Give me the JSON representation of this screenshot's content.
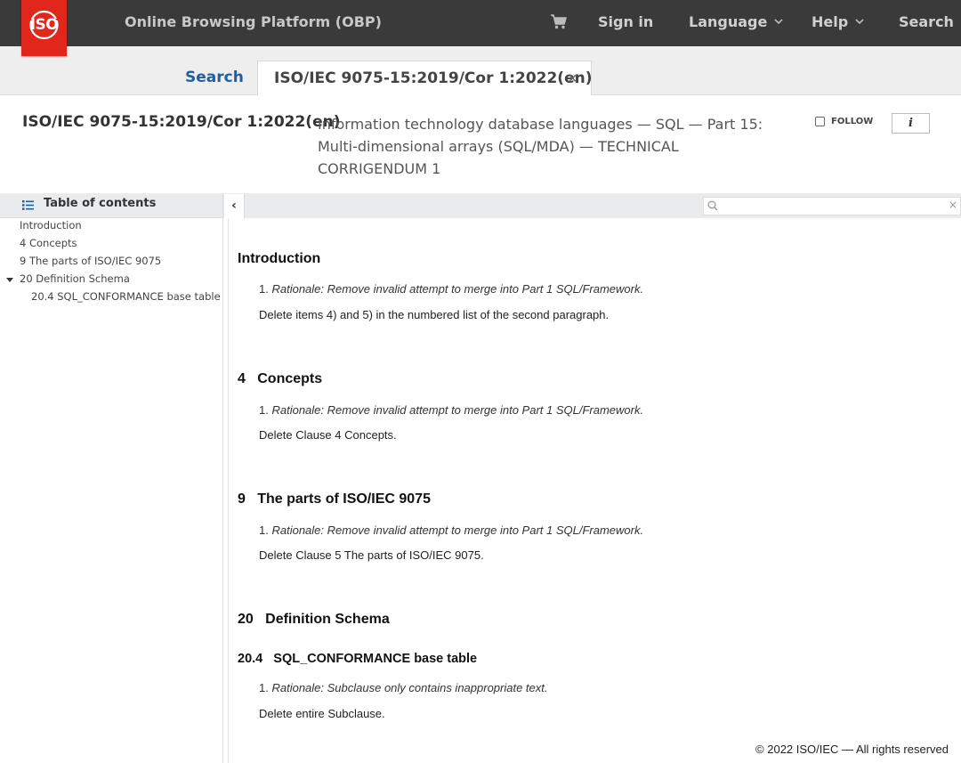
{
  "header": {
    "logo_text": "ISO",
    "app_title": "Online Browsing Platform (OBP)",
    "cart_icon": "cart-icon",
    "nav": {
      "sign_in": "Sign in",
      "language": "Language",
      "help": "Help",
      "search": "Search"
    }
  },
  "tabs": {
    "search_label": "Search",
    "doc_label": "ISO/IEC 9075-15:2019/Cor 1:2022(en)",
    "close_glyph": "×"
  },
  "document": {
    "reference": "ISO/IEC 9075-15:2019/Cor 1:2022(en)",
    "title": "Information technology database languages — SQL — Part 15: Multi-dimensional arrays (SQL/MDA) — TECHNICAL CORRIGENDUM 1",
    "follow_label": "FOLLOW",
    "info_label": "i"
  },
  "toc": {
    "heading": "Table of contents",
    "items": [
      "Introduction",
      "4 Concepts",
      "9 The parts of ISO/IEC 9075",
      "20 Definition Schema",
      "20.4 SQL_CONFORMANCE base table"
    ]
  },
  "toolbar": {
    "collapse_glyph": "‹",
    "search_placeholder": "",
    "clear_glyph": "×"
  },
  "content": {
    "sections": [
      {
        "heading": "Introduction",
        "rationale_prefix": "1. ",
        "rationale": "Rationale: Remove invalid attempt to merge into Part 1 SQL/Framework.",
        "instruction": "Delete items 4) and 5) in the numbered list of the second paragraph."
      },
      {
        "heading": "4   Concepts",
        "rationale_prefix": "1. ",
        "rationale": "Rationale: Remove invalid attempt to merge into Part 1 SQL/Framework.",
        "instruction": "Delete Clause 4 Concepts."
      },
      {
        "heading": "9   The parts of ISO/IEC 9075",
        "rationale_prefix": "1. ",
        "rationale": "Rationale: Remove invalid attempt to merge into Part 1 SQL/Framework.",
        "instruction": "Delete Clause 5 The parts of ISO/IEC 9075."
      },
      {
        "heading": "20   Definition Schema"
      },
      {
        "heading": "20.4   SQL_CONFORMANCE base table",
        "rationale_prefix": "1. ",
        "rationale": "Rationale: Subclause only contains inappropriate text.",
        "instruction": "Delete entire Subclause."
      }
    ],
    "footer": "© 2022 ISO/IEC — All rights reserved"
  },
  "colors": {
    "topbar": "#3a3a3a",
    "logo": "#e1261c",
    "link": "#1e5fa3"
  }
}
